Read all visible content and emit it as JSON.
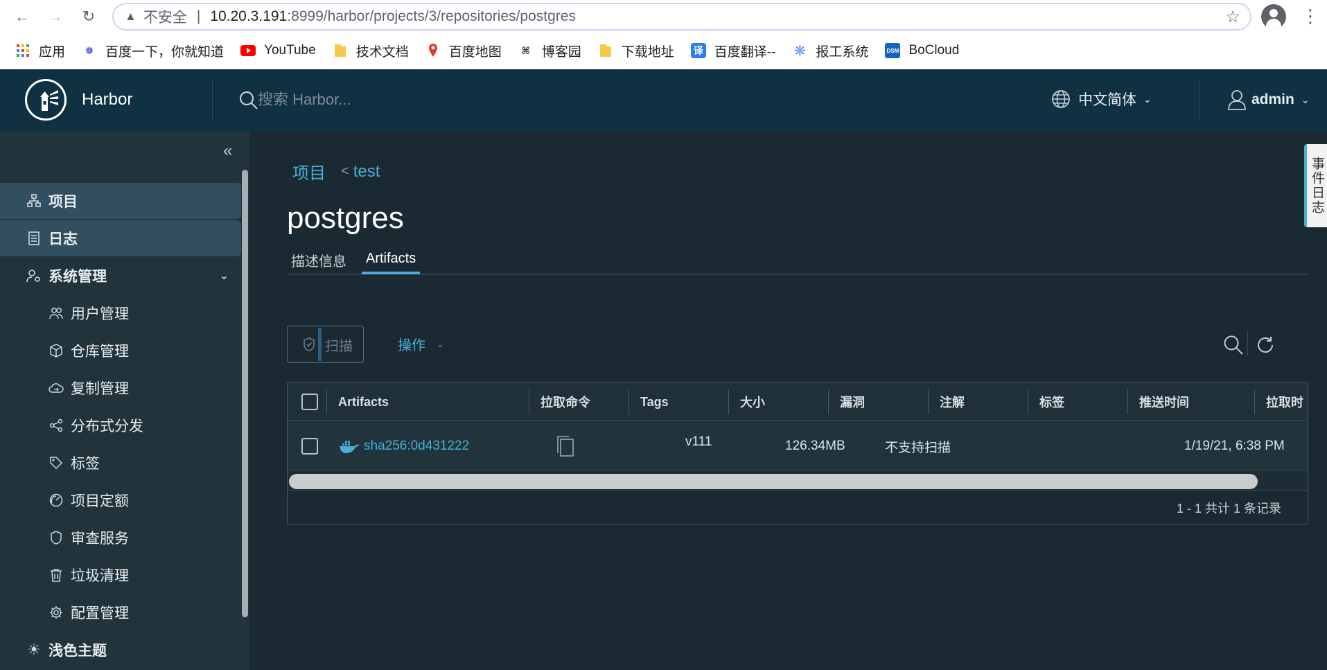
{
  "browser": {
    "security_label": "不安全",
    "url_host": "10.20.3.191",
    "url_rest": ":8999/harbor/projects/3/repositories/postgres",
    "bookmarks": [
      {
        "label": "应用",
        "icon": "apps-grid-icon",
        "color": "#4285f4"
      },
      {
        "label": "百度一下，你就知道",
        "icon": "baidu-paw-icon",
        "color": "#2932e1"
      },
      {
        "label": "YouTube",
        "icon": "youtube-icon",
        "color": "#ff0000"
      },
      {
        "label": "技术文档",
        "icon": "folder-icon",
        "color": "#f7c948"
      },
      {
        "label": "百度地图",
        "icon": "map-pin-icon",
        "color": "#e53935"
      },
      {
        "label": "博客园",
        "icon": "cnblogs-icon",
        "color": "#333333"
      },
      {
        "label": "下载地址",
        "icon": "folder-icon",
        "color": "#f7c948"
      },
      {
        "label": "百度翻译--",
        "icon": "translate-icon",
        "color": "#2c7cf6"
      },
      {
        "label": "报工系统",
        "icon": "pinwheel-icon",
        "color": "#5b8def"
      },
      {
        "label": "BoCloud",
        "icon": "dsm-icon",
        "color": "#1565c0"
      }
    ]
  },
  "header": {
    "brand": "Harbor",
    "search_placeholder": "搜索 Harbor...",
    "language": "中文简体",
    "user": "admin",
    "bg_color": "#0f3142"
  },
  "sidebar": {
    "items": [
      {
        "label": "项目",
        "icon": "projects-icon",
        "active": true
      },
      {
        "label": "日志",
        "icon": "logs-icon",
        "active": true
      },
      {
        "label": "系统管理",
        "icon": "admin-icon",
        "expanded": true
      },
      {
        "label": "用户管理",
        "icon": "users-icon"
      },
      {
        "label": "仓库管理",
        "icon": "registry-cube-icon"
      },
      {
        "label": "复制管理",
        "icon": "replication-cloud-icon"
      },
      {
        "label": "分布式分发",
        "icon": "share-icon"
      },
      {
        "label": "标签",
        "icon": "tag-icon"
      },
      {
        "label": "项目定额",
        "icon": "quota-gauge-icon"
      },
      {
        "label": "审查服务",
        "icon": "shield-icon"
      },
      {
        "label": "垃圾清理",
        "icon": "trash-icon"
      },
      {
        "label": "配置管理",
        "icon": "gear-icon"
      },
      {
        "label": "浅色主题",
        "icon": "sun-icon"
      }
    ]
  },
  "main": {
    "breadcrumb": {
      "root": "项目",
      "sep": "<",
      "project": "test"
    },
    "title": "postgres",
    "tabs": [
      {
        "label": "描述信息",
        "active": false
      },
      {
        "label": "Artifacts",
        "active": true
      }
    ],
    "scan_label": "扫描",
    "actions_label": "操作",
    "columns": [
      "Artifacts",
      "拉取命令",
      "Tags",
      "大小",
      "漏洞",
      "注解",
      "标签",
      "推送时间",
      "拉取时"
    ],
    "rows": [
      {
        "artifact": "sha256:0d431222",
        "tags": "v111",
        "size": "126.34MB",
        "vulnerability": "不支持扫描",
        "annotations": "",
        "labels": "",
        "push_time": "1/19/21, 6:38 PM"
      }
    ],
    "footer": "1 - 1 共计 1 条记录",
    "accent": "#49aedb"
  },
  "event_log_tab": "事件日志"
}
